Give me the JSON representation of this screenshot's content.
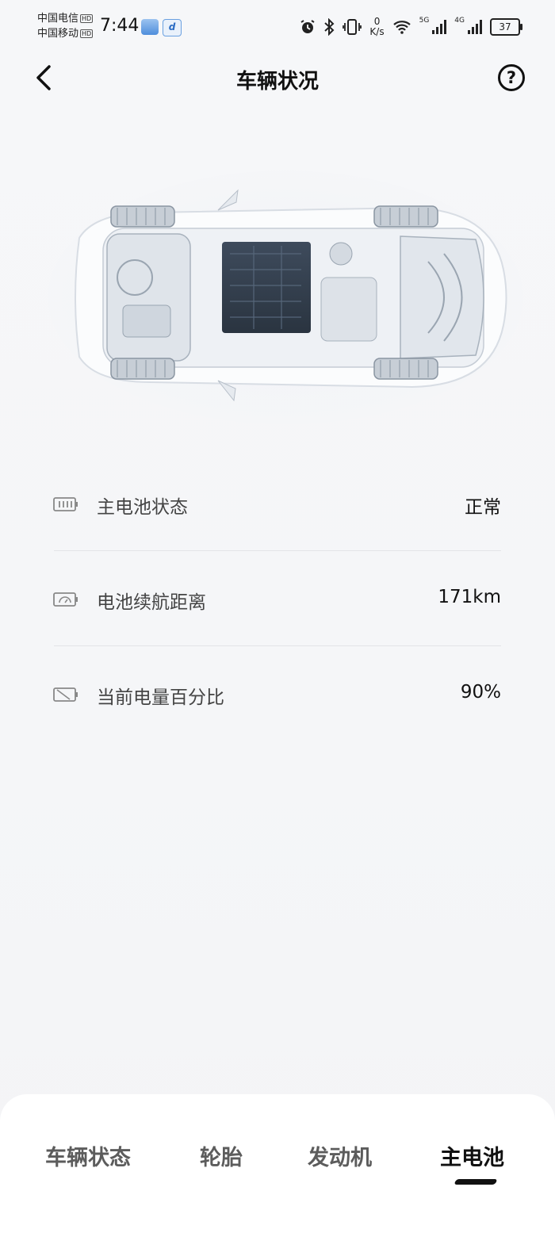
{
  "status_bar": {
    "carrier1": "中国电信",
    "carrier2": "中国移动",
    "hd": "HD",
    "time": "7:44",
    "net_speed_value": "0",
    "net_speed_unit": "K/s",
    "sig1": "5G",
    "sig2": "4G",
    "battery": "37",
    "icons": [
      "alarm-icon",
      "bluetooth-icon",
      "vibrate-icon",
      "wifi-icon",
      "signal-icon",
      "battery-icon"
    ]
  },
  "header": {
    "title": "车辆状况",
    "help": "?"
  },
  "battery_info": [
    {
      "label": "主电池状态",
      "value": "正常",
      "icon": "battery-level-icon"
    },
    {
      "label": "电池续航距离",
      "value": "171km",
      "icon": "range-gauge-icon"
    },
    {
      "label": "当前电量百分比",
      "value": "90%",
      "icon": "battery-percent-icon"
    }
  ],
  "tabs": [
    {
      "label": "车辆状态",
      "active": false
    },
    {
      "label": "轮胎",
      "active": false
    },
    {
      "label": "发动机",
      "active": false
    },
    {
      "label": "主电池",
      "active": true
    }
  ],
  "colors": {
    "background": "#f5f6f8",
    "text": "#111111",
    "label": "#444444",
    "divider": "#e3e4e7"
  }
}
